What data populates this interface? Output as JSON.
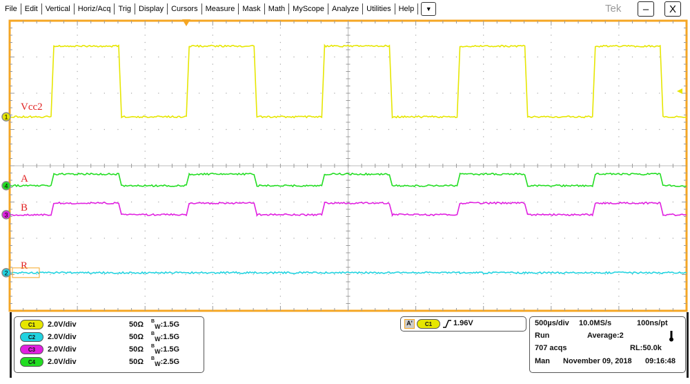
{
  "menu": [
    "File",
    "Edit",
    "Vertical",
    "Horiz/Acq",
    "Trig",
    "Display",
    "Cursors",
    "Measure",
    "Mask",
    "Math",
    "MyScope",
    "Analyze",
    "Utilities",
    "Help"
  ],
  "brand": "Tek",
  "window": {
    "minimize": "–",
    "close": "X",
    "dropdown": "▼"
  },
  "colors": {
    "grid_border": "#f5a623",
    "ch1": "#e6e600",
    "ch2": "#22d3e0",
    "ch3": "#e020e0",
    "ch4": "#22dd22",
    "label": "#e02020"
  },
  "traces": [
    {
      "ch": "1",
      "label": "Vcc2",
      "color": "#e6e600",
      "offset_div": 1.35,
      "amplitude_div": 1.95,
      "period_ms": 1.0,
      "duty": 0.5
    },
    {
      "ch": "4",
      "label": "A",
      "color": "#22dd22",
      "offset_div": -0.55,
      "amplitude_div": 0.32,
      "period_ms": 1.0,
      "duty": 0.5
    },
    {
      "ch": "3",
      "label": "B",
      "color": "#e020e0",
      "offset_div": -1.35,
      "amplitude_div": 0.32,
      "period_ms": 1.0,
      "duty": 0.5
    },
    {
      "ch": "2",
      "label": "R",
      "color": "#22d3e0",
      "offset_div": -2.95,
      "amplitude_div": 0,
      "period_ms": 1.0,
      "duty": 0.5
    }
  ],
  "channels": [
    {
      "name": "C1",
      "scale": "2.0V/div",
      "impedance": "50Ω",
      "bw_label": "W",
      "bw": ":1.5G",
      "color": "#e6e600"
    },
    {
      "name": "C2",
      "scale": "2.0V/div",
      "impedance": "50Ω",
      "bw_label": "W",
      "bw": ":1.5G",
      "color": "#22d3e0"
    },
    {
      "name": "C3",
      "scale": "2.0V/div",
      "impedance": "50Ω",
      "bw_label": "W",
      "bw": ":1.5G",
      "color": "#e020e0"
    },
    {
      "name": "C4",
      "scale": "2.0V/div",
      "impedance": "50Ω",
      "bw_label": "W",
      "bw": ":2.5G",
      "color": "#22dd22"
    }
  ],
  "trigger": {
    "mode": "A'",
    "source": "C1",
    "level": "1.96V"
  },
  "acq": {
    "timebase": "500µs/div",
    "sample_rate": "10.0MS/s",
    "resolution": "100ns/pt",
    "state": "Run",
    "average": "Average:2",
    "acqs": "707 acqs",
    "record_length": "RL:50.0k",
    "trigger_mode": "Man",
    "date": "November 09, 2018",
    "time": "09:16:48"
  }
}
